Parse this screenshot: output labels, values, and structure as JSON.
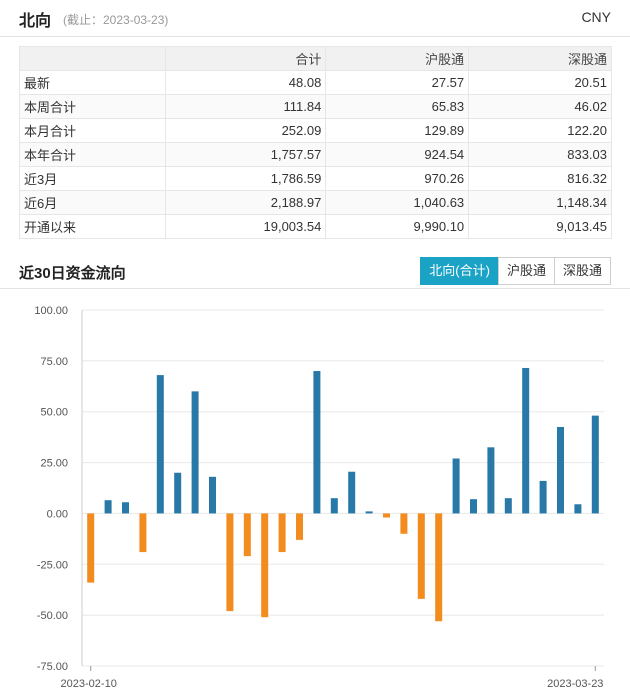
{
  "header": {
    "title": "北向",
    "date": "(截止：2023-03-23)",
    "currency": "CNY"
  },
  "summary": {
    "columns": [
      "",
      "合计",
      "沪股通",
      "深股通"
    ],
    "rows": [
      {
        "label": "最新",
        "values": [
          "48.08",
          "27.57",
          "20.51"
        ]
      },
      {
        "label": "本周合计",
        "values": [
          "111.84",
          "65.83",
          "46.02"
        ]
      },
      {
        "label": "本月合计",
        "values": [
          "252.09",
          "129.89",
          "122.20"
        ]
      },
      {
        "label": "本年合计",
        "values": [
          "1,757.57",
          "924.54",
          "833.03"
        ]
      },
      {
        "label": "近3月",
        "values": [
          "1,786.59",
          "970.26",
          "816.32"
        ]
      },
      {
        "label": "近6月",
        "values": [
          "2,188.97",
          "1,040.63",
          "1,148.34"
        ]
      },
      {
        "label": "开通以来",
        "values": [
          "19,003.54",
          "9,990.10",
          "9,013.45"
        ]
      }
    ]
  },
  "flow_section": {
    "title": "近30日资金流向",
    "tabs": [
      {
        "label": "北向(合计)",
        "active": true
      },
      {
        "label": "沪股通",
        "active": false
      },
      {
        "label": "深股通",
        "active": false
      }
    ]
  },
  "colors": {
    "positive": "#2878a8",
    "negative": "#f28c1e",
    "accent": "#1ba3c6"
  },
  "chart_data": {
    "type": "bar",
    "ylim": [
      -75,
      100
    ],
    "yticks": [
      100,
      75,
      50,
      25,
      0,
      -25,
      -50,
      -75
    ],
    "ytick_labels": [
      "100.00",
      "75.00",
      "50.00",
      "25.00",
      "0.00",
      "-25.00",
      "-50.00",
      "-75.00"
    ],
    "x_first_label": "2023-02-10",
    "x_last_label": "2023-03-23",
    "values": [
      -34,
      6.5,
      5.5,
      -19,
      68,
      20,
      60,
      18,
      -48,
      -21,
      -51,
      -19,
      -13,
      70,
      7.5,
      20.5,
      1,
      -2,
      -10,
      -42,
      -53,
      27,
      7,
      32.5,
      7.5,
      71.5,
      16,
      42.5,
      4.5,
      48.08
    ],
    "grid": true
  }
}
